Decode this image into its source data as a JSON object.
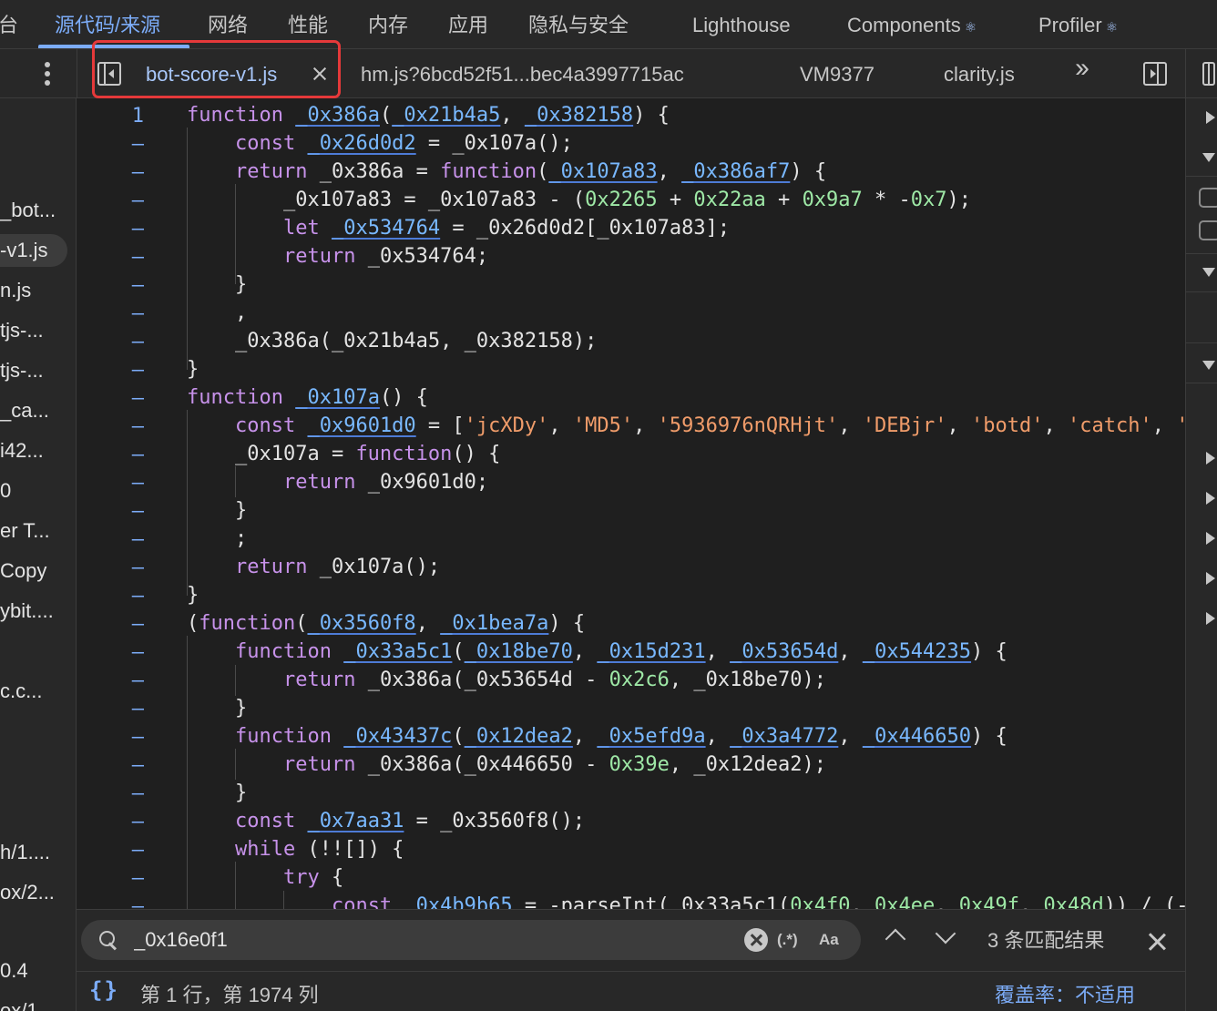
{
  "top_tabs": [
    {
      "label": "台",
      "active": false
    },
    {
      "label": "源代码/来源",
      "active": true
    },
    {
      "label": "网络",
      "active": false
    },
    {
      "label": "性能",
      "active": false
    },
    {
      "label": "内存",
      "active": false
    },
    {
      "label": "应用",
      "active": false
    },
    {
      "label": "隐私与安全",
      "active": false
    },
    {
      "label": "Lighthouse",
      "active": false
    },
    {
      "label": "Components",
      "active": false,
      "icon": "react-icon"
    },
    {
      "label": "Profiler",
      "active": false,
      "icon": "react-icon"
    }
  ],
  "file_tabs": [
    {
      "label": "bot-score-v1.js",
      "active": true,
      "closable": true,
      "highlighted": true
    },
    {
      "label": "hm.js?6bcd52f51...bec4a3997715ac",
      "active": false
    },
    {
      "label": "VM9377",
      "active": false
    },
    {
      "label": "clarity.js",
      "active": false
    }
  ],
  "navigator_items": [
    {
      "label": "_bot...",
      "selected": false
    },
    {
      "label": "-v1.js",
      "selected": true
    },
    {
      "label": "n.js",
      "selected": false
    },
    {
      "label": "tjs-...",
      "selected": false
    },
    {
      "label": "tjs-...",
      "selected": false
    },
    {
      "label": "_ca...",
      "selected": false
    },
    {
      "label": "i42...",
      "selected": false
    },
    {
      "label": "0",
      "selected": false
    },
    {
      "label": "er T...",
      "selected": false
    },
    {
      "label": "Copy",
      "selected": false
    },
    {
      "label": "ybit....",
      "selected": false
    },
    {
      "label": "c.c...",
      "selected": false
    },
    {
      "label": "h/1....",
      "selected": false
    },
    {
      "label": "ox/2...",
      "selected": false
    },
    {
      "label": "0.4",
      "selected": false
    },
    {
      "label": "ox/1",
      "selected": false
    }
  ],
  "code": {
    "line_numbers": [
      "1",
      "–",
      "–",
      "–",
      "–",
      "–",
      "–",
      "–",
      "–",
      "–",
      "–",
      "–",
      "–",
      "–",
      "–",
      "–",
      "–",
      "–",
      "–",
      "–",
      "–",
      "–",
      "–",
      "–",
      "–",
      "–",
      "–",
      "–",
      "–"
    ],
    "lines": [
      "function _0x386a(_0x21b4a5, _0x382158) {",
      "    const _0x26d0d2 = _0x107a();",
      "    return _0x386a = function(_0x107a83, _0x386af7) {",
      "        _0x107a83 = _0x107a83 - (0x2265 + 0x22aa + 0x9a7 * -0x7);",
      "        let _0x534764 = _0x26d0d2[_0x107a83];",
      "        return _0x534764;",
      "    }",
      "    ,",
      "    _0x386a(_0x21b4a5, _0x382158);",
      "}",
      "function _0x107a() {",
      "    const _0x9601d0 = ['jcXDy', 'MD5', '5936976nQRHjt', 'DEBjr', 'botd', 'catch', '",
      "    _0x107a = function() {",
      "        return _0x9601d0;",
      "    }",
      "    ;",
      "    return _0x107a();",
      "}",
      "(function(_0x3560f8, _0x1bea7a) {",
      "    function _0x33a5c1(_0x18be70, _0x15d231, _0x53654d, _0x544235) {",
      "        return _0x386a(_0x53654d - 0x2c6, _0x18be70);",
      "    }",
      "    function _0x43437c(_0x12dea2, _0x5efd9a, _0x3a4772, _0x446650) {",
      "        return _0x386a(_0x446650 - 0x39e, _0x12dea2);",
      "    }",
      "    const _0x7aa31 = _0x3560f8();",
      "    while (!![]) {",
      "        try {",
      "            const _0x4b9b65 = -parseInt(_0x33a5c1(0x4f0, 0x4ee, 0x49f, 0x48d)) / (-"
    ]
  },
  "search": {
    "query": "_0x16e0f1",
    "regex_label": "(.*)",
    "case_label": "Aa",
    "match_count": "3 条匹配结果"
  },
  "status": {
    "cursor_position": "第 1 行，第 1974 列",
    "pretty_print_label": "{}",
    "coverage": "覆盖率：不适用"
  },
  "colors": {
    "accent": "#7cacf8",
    "highlight_box": "#e5393a",
    "editor_bg": "#1f1f1f",
    "panel_bg": "#282828"
  }
}
